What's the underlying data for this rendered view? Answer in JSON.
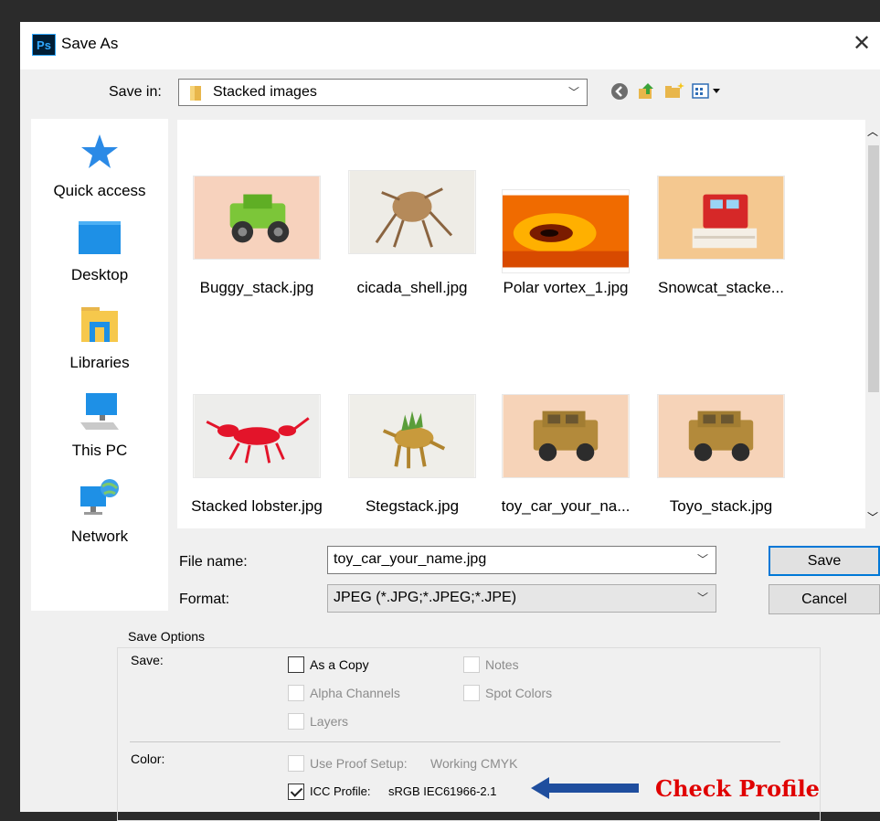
{
  "window": {
    "title": "Save As",
    "app_badge": "Ps"
  },
  "save_in": {
    "label": "Save in:",
    "value": "Stacked images"
  },
  "nav": [
    {
      "label": "Quick access",
      "icon": "star-icon"
    },
    {
      "label": "Desktop",
      "icon": "desktop-icon"
    },
    {
      "label": "Libraries",
      "icon": "libraries-icon"
    },
    {
      "label": "This PC",
      "icon": "computer-icon"
    },
    {
      "label": "Network",
      "icon": "network-icon"
    }
  ],
  "files": [
    {
      "name": "Buggy_stack.jpg"
    },
    {
      "name": "cicada_shell.jpg"
    },
    {
      "name": "Polar vortex_1.jpg"
    },
    {
      "name": "Snowcat_stacke..."
    },
    {
      "name": "Stacked lobster.jpg"
    },
    {
      "name": "Stegstack.jpg"
    },
    {
      "name": "toy_car_your_na..."
    },
    {
      "name": "Toyo_stack.jpg"
    }
  ],
  "file_name": {
    "label": "File name:",
    "value": "toy_car_your_name.jpg"
  },
  "format": {
    "label": "Format:",
    "value": "JPEG (*.JPG;*.JPEG;*.JPE)"
  },
  "buttons": {
    "save": "Save",
    "cancel": "Cancel"
  },
  "save_options": {
    "title": "Save Options",
    "save_label": "Save:",
    "as_a_copy": "As a Copy",
    "notes": "Notes",
    "alpha_channels": "Alpha Channels",
    "spot_colors": "Spot Colors",
    "layers": "Layers",
    "color_label": "Color:",
    "use_proof_setup": "Use Proof Setup:",
    "proof_value": "Working CMYK",
    "icc_profile": "ICC Profile:",
    "icc_value": "sRGB IEC61966-2.1"
  },
  "annotation": {
    "text": "Check Profile",
    "color": "#e00000",
    "arrow_color": "#1f4e9e"
  },
  "colors": {
    "accent": "#0078d7",
    "dialog_bg": "#f0f0f0"
  }
}
